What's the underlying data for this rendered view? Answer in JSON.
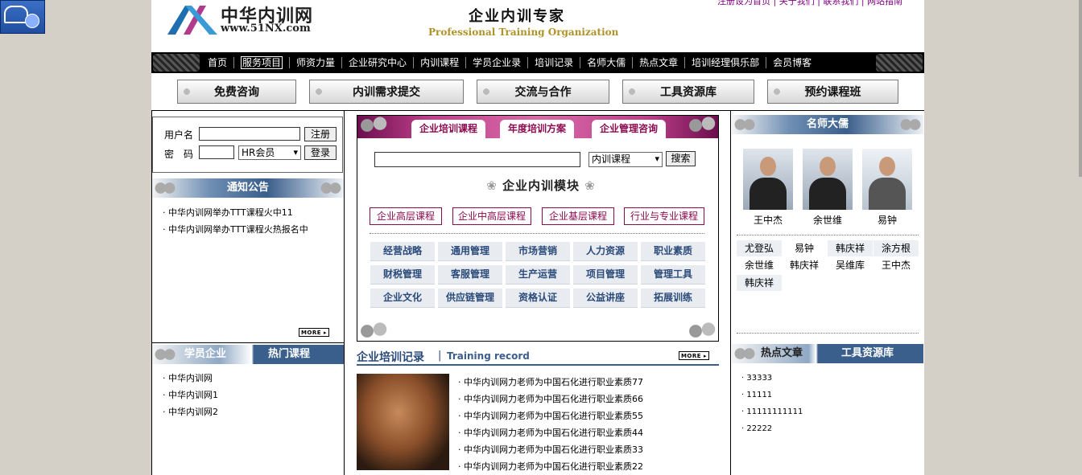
{
  "header": {
    "logo_cn": "中华内训网",
    "logo_en": "www.51NX.com",
    "slogan_cn": "企业内训专家",
    "slogan_en": "Professional Training Organization",
    "top_links": "注册设为首页 | 关于我们 | 联系我们 | 网站指南"
  },
  "nav": [
    "首页",
    "服务项目",
    "师资力量",
    "企业研究中心",
    "内训课程",
    "学员企业录",
    "培训记录",
    "名师大儒",
    "热点文章",
    "培训经理俱乐部",
    "会员博客"
  ],
  "buttons": [
    "免费咨询",
    "内训需求提交",
    "交流与合作",
    "工具资源库",
    "预约课程班"
  ],
  "login": {
    "username_label": "用户名",
    "password_label": "密　码",
    "register": "注册",
    "login": "登录",
    "member_type": "HR会员"
  },
  "notice": {
    "title": "通知公告",
    "items": [
      "中华内训网举办TTT课程火中11",
      "中华内训网举办TTT课程火热报名中"
    ],
    "more": "MORE"
  },
  "student": {
    "tab1": "学员企业",
    "tab2": "热门课程",
    "items": [
      "中华内训网",
      "中华内训网1",
      "中华内训网2"
    ]
  },
  "center": {
    "tabs": [
      "企业培训课程",
      "年度培训方案",
      "企业管理咨询"
    ],
    "search_select": "内训课程",
    "search_button": "搜索",
    "module_title": "企业内训模块",
    "levels": [
      "企业高层课程",
      "企业中高层课程",
      "企业基层课程",
      "行业与专业课程"
    ],
    "grid": [
      "经营战略",
      "通用管理",
      "市场营销",
      "人力资源",
      "职业素质",
      "财税管理",
      "客服管理",
      "生产运营",
      "项目管理",
      "管理工具",
      "企业文化",
      "供应链管理",
      "资格认证",
      "公益讲座",
      "拓展训练"
    ]
  },
  "records": {
    "title_cn": "企业培训记录",
    "title_en": "Training record",
    "more": "MORE",
    "items": [
      "中华内训网力老师为中国石化进行职业素质77",
      "中华内训网力老师为中国石化进行职业素质66",
      "中华内训网力老师为中国石化进行职业素质55",
      "中华内训网力老师为中国石化进行职业素质44",
      "中华内训网力老师为中国石化进行职业素质33",
      "中华内训网力老师为中国石化进行职业素质22"
    ]
  },
  "masters": {
    "title": "名师大儒",
    "featured": [
      "王中杰",
      "余世维",
      "易钟"
    ],
    "names": [
      "尤登弘",
      "易钟",
      "韩庆祥",
      "涂方根",
      "余世维",
      "韩庆祥",
      "吴维库",
      "王中杰",
      "韩庆祥"
    ]
  },
  "hot": {
    "tab1": "热点文章",
    "tab2": "工具资源库",
    "items": [
      "33333",
      "11111",
      "11111111111",
      "22222"
    ]
  }
}
